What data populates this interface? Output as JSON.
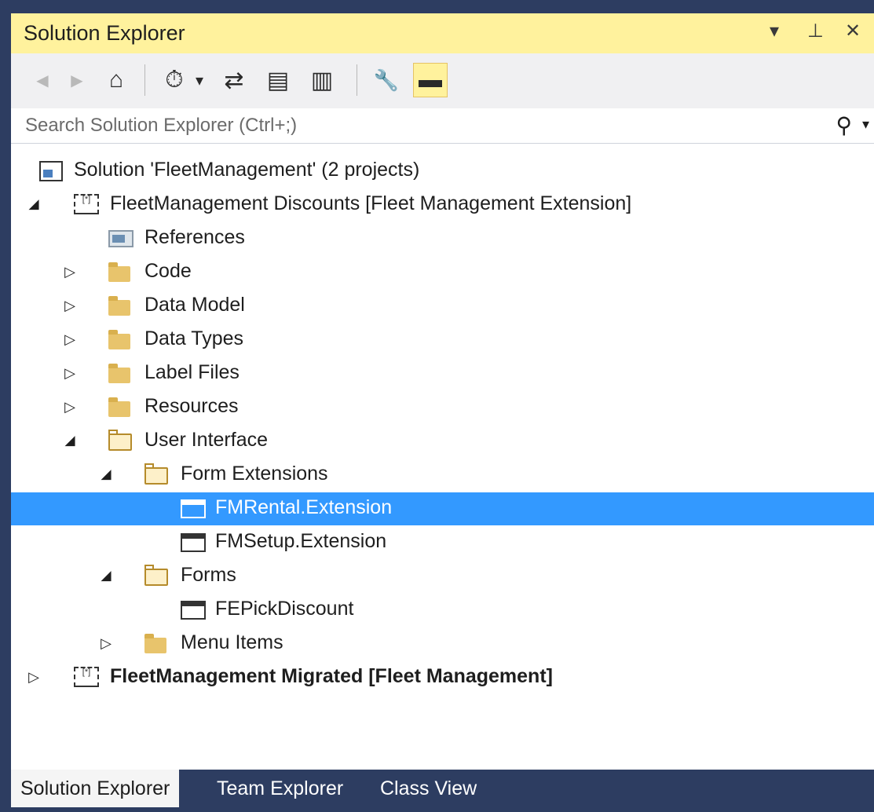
{
  "panel": {
    "title": "Solution Explorer",
    "dropdown_glyph": "▾",
    "pin_glyph": "⊥",
    "close_glyph": "✕"
  },
  "toolbar": {
    "back_icon": "◀",
    "forward_icon": "▶",
    "home_icon": "⌂",
    "pending_changes_icon": "⏱",
    "pending_dropdown": "▾",
    "sync_icon": "⇄",
    "collapse_all_icon": "▤",
    "show_all_files_icon": "▥",
    "properties_icon": "🔧",
    "collapse_toggle_icon": "▬"
  },
  "search": {
    "placeholder": "Search Solution Explorer (Ctrl+;)",
    "icon": "⚲",
    "dropdown": "▾"
  },
  "tree": {
    "solution": "Solution 'FleetManagement' (2 projects)",
    "project1": "FleetManagement Discounts [Fleet Management Extension]",
    "references": "References",
    "code": "Code",
    "data_model": "Data Model",
    "data_types": "Data Types",
    "label_files": "Label Files",
    "resources": "Resources",
    "user_interface": "User Interface",
    "form_extensions": "Form Extensions",
    "fmrental": "FMRental.Extension",
    "fmsetup": "FMSetup.Extension",
    "forms": "Forms",
    "fepick": "FEPickDiscount",
    "menu_items": "Menu Items",
    "project2": "FleetManagement Migrated [Fleet Management]",
    "arrow_collapsed": "▷",
    "arrow_expanded": "◢",
    "project_icon_text": "[*]"
  },
  "tabs": {
    "solution_explorer": "Solution Explorer",
    "team_explorer": "Team Explorer",
    "class_view": "Class View"
  },
  "colors": {
    "title_active": "#fff29d",
    "selection": "#3399ff",
    "frame": "#2d3d61"
  }
}
